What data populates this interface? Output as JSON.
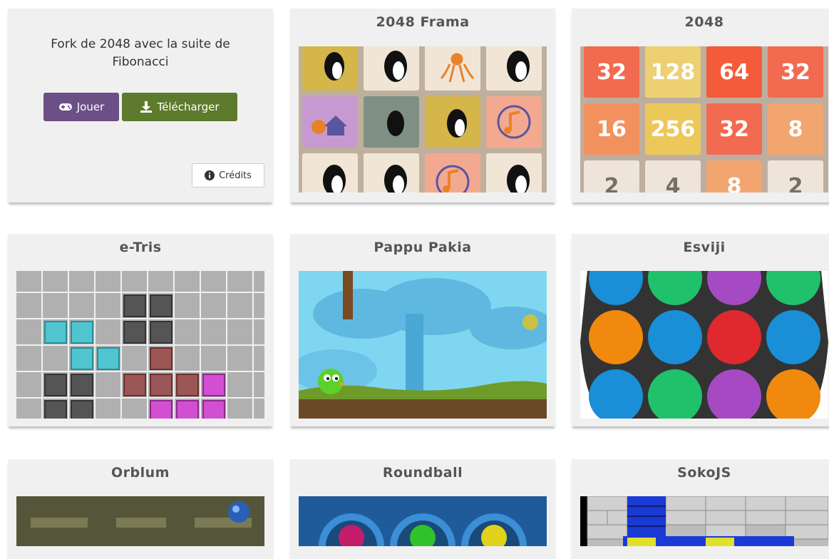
{
  "featured": {
    "description": "Fork de 2048 avec la suite de Fibonacci",
    "play_label": "Jouer",
    "download_label": "Télécharger",
    "credits_label": "Crédits"
  },
  "games": [
    {
      "title": "2048 Frama"
    },
    {
      "title": "2048"
    },
    {
      "title": "e-Tris"
    },
    {
      "title": "Pappu Pakia"
    },
    {
      "title": "Esviji"
    },
    {
      "title": "Orblum"
    },
    {
      "title": "Roundball"
    },
    {
      "title": "SokoJS"
    }
  ],
  "thumb_2048": {
    "tiles": [
      "32",
      "128",
      "64",
      "32",
      "16",
      "256",
      "32",
      "8",
      "2",
      "4",
      "8",
      "2"
    ]
  },
  "colors": {
    "play_button": "#6b4f85",
    "download_button": "#5e7a2d",
    "card_bg": "#f0f0f0"
  }
}
